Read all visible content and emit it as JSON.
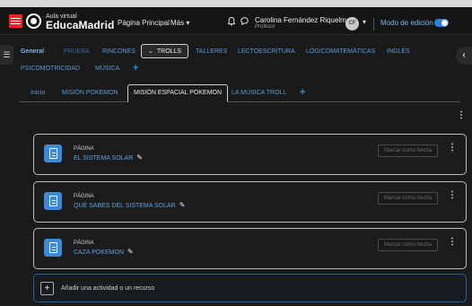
{
  "header": {
    "brand_small": "Aula virtual",
    "brand_big": "EducaMadrid",
    "nav_home": "Página Principal",
    "nav_more": "Más ▾",
    "user_name": "Carolina Fernández Riquelme",
    "user_role": "Profesor",
    "avatar_initials": "CF",
    "edit_mode_label": "Modo de edición",
    "edit_mode_on": true
  },
  "course_tabs": {
    "row1": [
      "General",
      "PRUEBA",
      "RINCONES",
      "TROLLS",
      "TALLERES",
      "LECTOESCRITURA",
      "LÓGICOMATEMÁTICAS",
      "INGLÉS"
    ],
    "row2": [
      "PSICOMOTRICIDAD",
      "MÚSICA"
    ],
    "add": "+",
    "selected_prefix": "⌄"
  },
  "sub_tabs": {
    "items": [
      "Inicio",
      "MISIÓN POKEMON",
      "MISIÓN ESPACIAL POKEMON",
      "LA MÚSICA TROLL"
    ],
    "add": "+"
  },
  "activities": [
    {
      "type": "PÁGINA",
      "title": "EL SISTEMA SOLAR",
      "mark_label": "Marcar como hecha"
    },
    {
      "type": "PÁGINA",
      "title": "QUÉ SABES DEL SISTEMA SOLAR",
      "mark_label": "Marcar como hecha"
    },
    {
      "type": "PÁGINA",
      "title": "CAZA POKEMON",
      "mark_label": "Marcar como hecha"
    }
  ],
  "add_activity": {
    "icon": "+",
    "label": "Añadir una actividad o un recurso"
  },
  "icons": {
    "kebab": "⋮",
    "pencil": "✎",
    "bell": "🔔",
    "chat": "💬",
    "chevron_down": "▾",
    "menu": "☰",
    "chevron_left": "‹"
  },
  "colors": {
    "accent": "#3b8ad8",
    "link": "#5b9bd6",
    "brand_red": "#e4262c"
  }
}
